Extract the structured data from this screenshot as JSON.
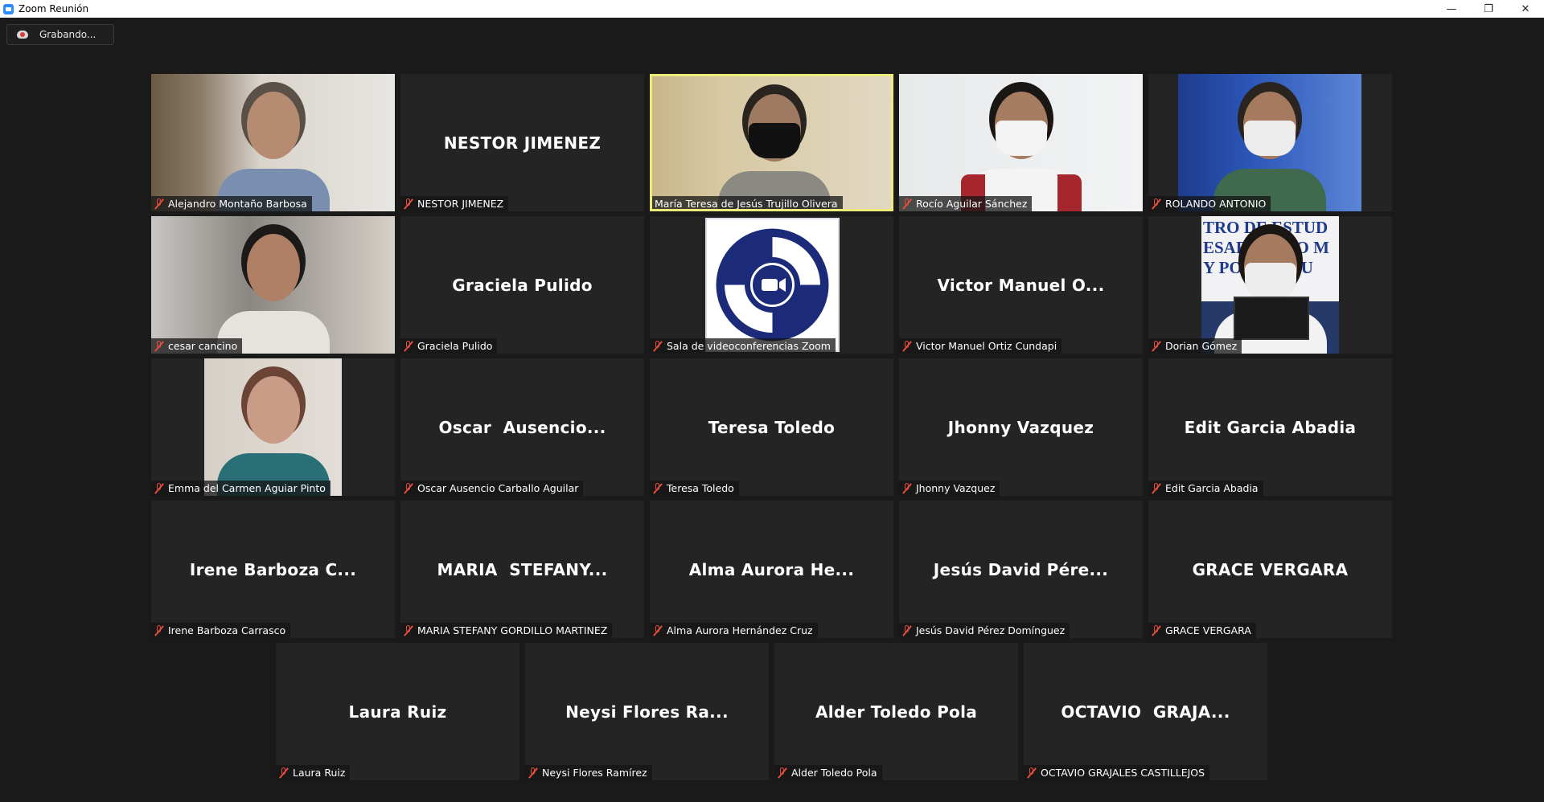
{
  "window": {
    "title": "Zoom Reunión",
    "minimize_glyph": "—",
    "restore_glyph": "❐",
    "close_glyph": "✕"
  },
  "recording": {
    "label": "Grabando...",
    "icon": "cloud-record-icon"
  },
  "colors": {
    "background": "#1a1a1a",
    "tile": "#242424",
    "active_border": "#ecec7a",
    "muted_icon": "#e74c3c"
  },
  "participants": [
    {
      "label": "Alejandro Montaño Barbosa",
      "display": "",
      "video": true,
      "muted": true
    },
    {
      "label": "NESTOR JIMENEZ",
      "display": "NESTOR JIMENEZ",
      "video": false,
      "muted": true
    },
    {
      "label": "María Teresa de Jesús Trujillo Olivera",
      "display": "",
      "video": true,
      "muted": false,
      "active_speaker": true
    },
    {
      "label": "Rocío Aguilar Sánchez",
      "display": "",
      "video": true,
      "muted": true
    },
    {
      "label": "ROLANDO ANTONIO",
      "display": "",
      "video": true,
      "muted": true
    },
    {
      "label": "cesar cancino",
      "display": "",
      "video": true,
      "muted": true
    },
    {
      "label": "Graciela Pulido",
      "display": "Graciela Pulido",
      "video": false,
      "muted": true
    },
    {
      "label": "Sala de videoconferencias Zoom",
      "display": "",
      "video": true,
      "muted": true
    },
    {
      "label": "Victor Manuel Ortiz Cundapi",
      "display": "Victor Manuel O...",
      "video": false,
      "muted": true
    },
    {
      "label": "Dorian Gómez",
      "display": "",
      "video": true,
      "muted": true
    },
    {
      "label": "Emma del Carmen Aguiar Pinto",
      "display": "",
      "video": true,
      "muted": true
    },
    {
      "label": "Oscar Ausencio Carballo Aguilar",
      "display": "Oscar  Ausencio...",
      "video": false,
      "muted": true
    },
    {
      "label": "Teresa Toledo",
      "display": "Teresa Toledo",
      "video": false,
      "muted": true
    },
    {
      "label": "Jhonny Vazquez",
      "display": "Jhonny Vazquez",
      "video": false,
      "muted": true
    },
    {
      "label": "Edit Garcia Abadia",
      "display": "Edit Garcia Abadia",
      "video": false,
      "muted": true
    },
    {
      "label": "Irene Barboza Carrasco",
      "display": "Irene Barboza C...",
      "video": false,
      "muted": true
    },
    {
      "label": "MARIA STEFANY GORDILLO MARTINEZ",
      "display": "MARIA  STEFANY...",
      "video": false,
      "muted": true
    },
    {
      "label": "Alma Aurora Hernández Cruz",
      "display": "Alma Aurora He...",
      "video": false,
      "muted": true
    },
    {
      "label": "Jesús David Pérez Domínguez",
      "display": "Jesús David Pére...",
      "video": false,
      "muted": true
    },
    {
      "label": "GRACE VERGARA",
      "display": "GRACE VERGARA",
      "video": false,
      "muted": true
    },
    {
      "label": "Laura Ruiz",
      "display": "Laura Ruiz",
      "video": false,
      "muted": true
    },
    {
      "label": "Neysi Flores Ramírez",
      "display": "Neysi Flores Ra...",
      "video": false,
      "muted": true
    },
    {
      "label": "Alder Toledo Pola",
      "display": "Alder Toledo Pola",
      "video": false,
      "muted": true
    },
    {
      "label": "OCTAVIO GRAJALES CASTILLEJOS",
      "display": "OCTAVIO  GRAJA...",
      "video": false,
      "muted": true
    }
  ],
  "banner_text": "TRO DE ESTUD\nESARROLLO M\nY POLÍ    S PU"
}
